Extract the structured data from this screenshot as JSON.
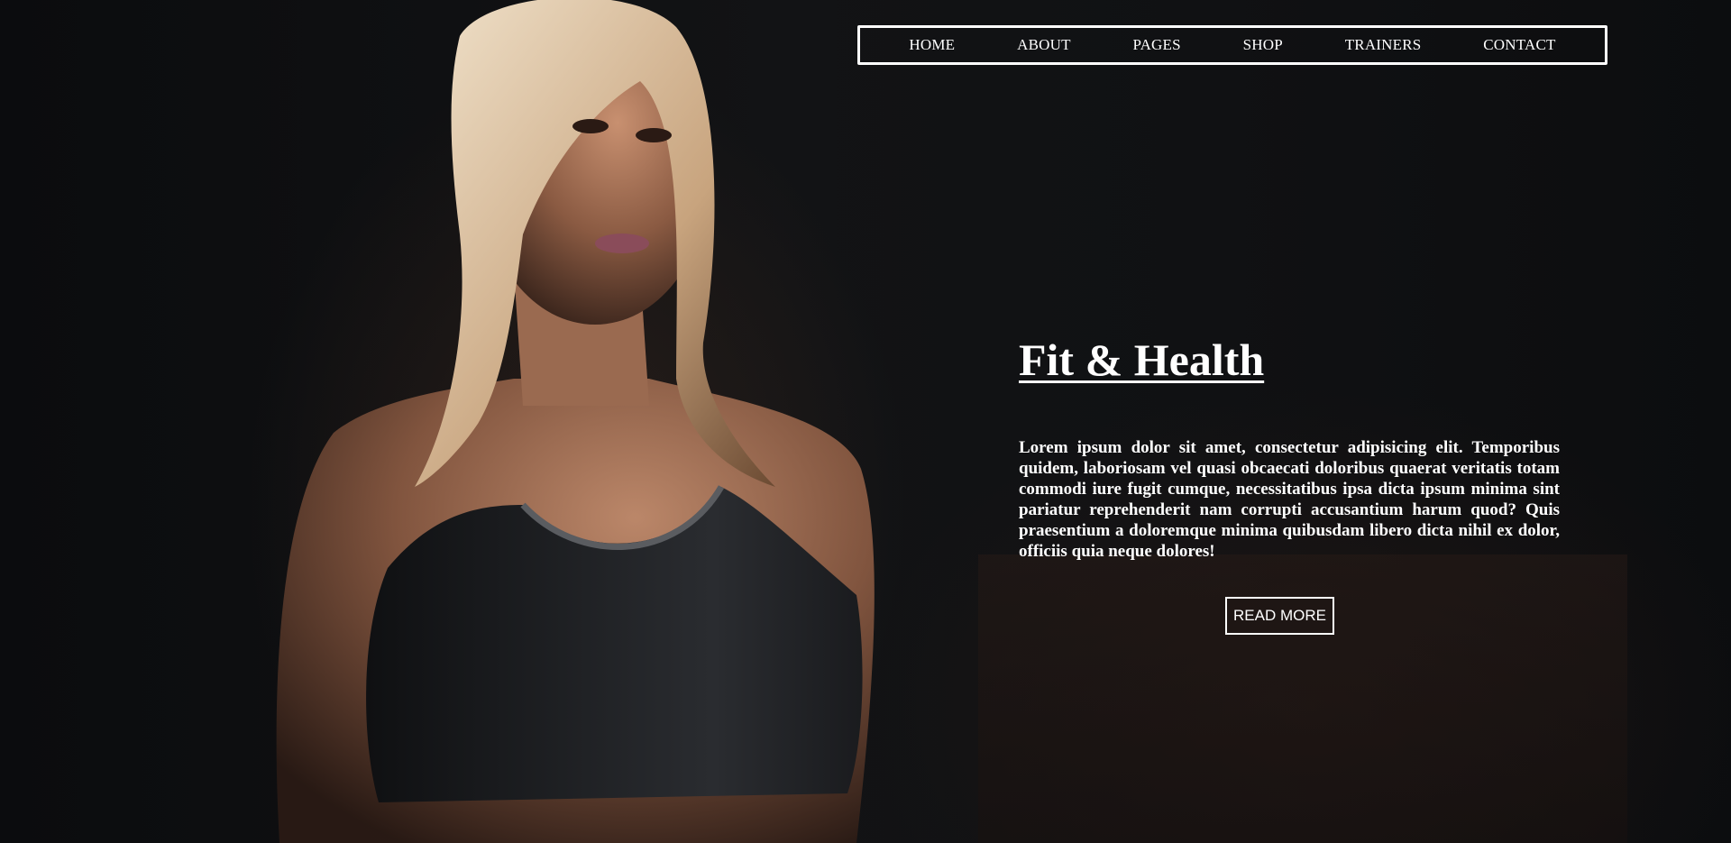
{
  "nav": {
    "items": [
      {
        "label": "HOME"
      },
      {
        "label": "ABOUT"
      },
      {
        "label": "PAGES"
      },
      {
        "label": "SHOP"
      },
      {
        "label": "TRAINERS"
      },
      {
        "label": "CONTACT"
      }
    ]
  },
  "hero": {
    "title": "Fit & Health",
    "text": "Lorem ipsum dolor sit amet, consectetur adipisicing elit. Temporibus quidem, laboriosam vel quasi obcaecati doloribus quaerat veritatis totam commodi iure fugit cumque, necessitatibus ipsa dicta ipsum minima sint pariatur reprehenderit nam corrupti accusantium harum quod? Quis praesentium a doloremque minima quibusdam libero dicta nihil ex dolor, officiis quia neque dolores!",
    "button_label": "READ MORE"
  },
  "colors": {
    "background": "#0d0e10",
    "text": "#ffffff",
    "skin": "#b07a5a",
    "hair": "#d9c2a0",
    "top": "#1e1f22"
  }
}
